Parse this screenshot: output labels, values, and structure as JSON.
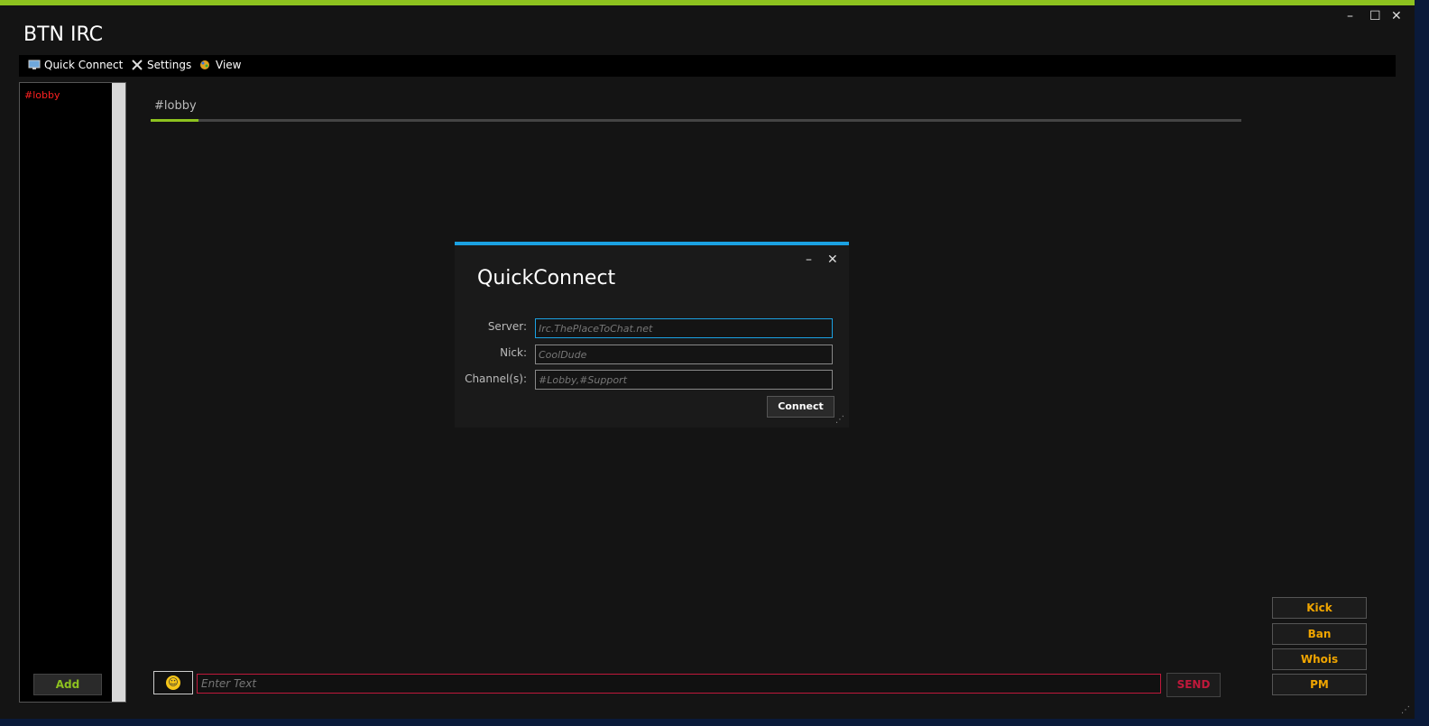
{
  "app": {
    "title": "BTN IRC",
    "window_controls": {
      "minimize": "–",
      "maximize": "☐",
      "close": "✕"
    }
  },
  "menu": {
    "items": [
      {
        "label": "Quick Connect",
        "icon": "computer-icon"
      },
      {
        "label": "Settings",
        "icon": "tools-icon"
      },
      {
        "label": "View",
        "icon": "palette-icon"
      }
    ]
  },
  "sidebar": {
    "channels": [
      "#lobby"
    ],
    "add_label": "Add"
  },
  "main": {
    "tabs": [
      {
        "label": "#lobby",
        "active": true
      }
    ]
  },
  "input": {
    "placeholder": "Enter Text",
    "send_label": "SEND",
    "emoji_icon": "smiley-icon"
  },
  "actions": {
    "buttons": [
      "Kick",
      "Ban",
      "Whois",
      "PM"
    ]
  },
  "quick_connect": {
    "title": "QuickConnect",
    "server_label": "Server:",
    "server_placeholder": "Irc.ThePlaceToChat.net",
    "nick_label": "Nick:",
    "nick_placeholder": "CoolDude",
    "channels_label": "Channel(s):",
    "channels_placeholder": "#Lobby,#Support",
    "connect_label": "Connect"
  },
  "colors": {
    "accent_green": "#8dc21f",
    "accent_blue": "#1ba1e2",
    "alert_red": "#c0183b",
    "action_orange": "#f0a500"
  }
}
